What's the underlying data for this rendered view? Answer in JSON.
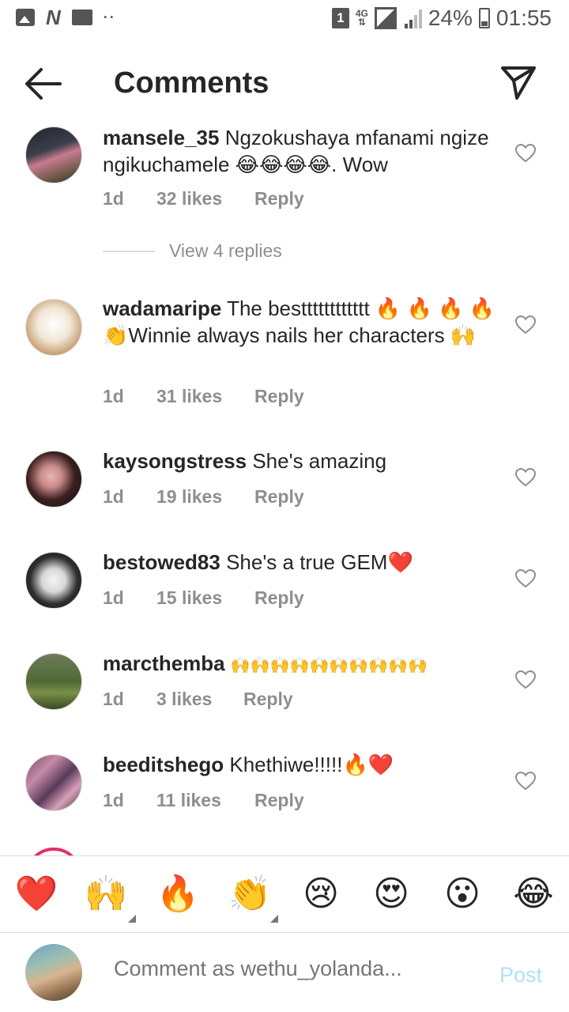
{
  "status_bar": {
    "notification_badge": "1",
    "network": "4G",
    "battery": "24%",
    "time": "01:55"
  },
  "header": {
    "title": "Comments"
  },
  "comments": [
    {
      "user": "mansele_35",
      "text": "Ngzokushaya mfanami ngize ngikuchamele 😂😂😂😂. Wow",
      "age": "1d",
      "likes": "32 likes",
      "reply": "Reply"
    },
    {
      "user": "wadamaripe",
      "text": "The bestttttttttttt 🔥 🔥 🔥 🔥 👏Winnie always nails her characters 🙌",
      "age": "1d",
      "likes": "31 likes",
      "reply": "Reply"
    },
    {
      "user": "kaysongstress",
      "text": "She's amazing",
      "age": "1d",
      "likes": "19 likes",
      "reply": "Reply"
    },
    {
      "user": "bestowed83",
      "text": "She's a true GEM❤️",
      "age": "1d",
      "likes": "15 likes",
      "reply": "Reply"
    },
    {
      "user": "marcthemba",
      "text": "🙌🙌🙌🙌🙌🙌🙌🙌🙌🙌",
      "age": "1d",
      "likes": "3 likes",
      "reply": "Reply"
    },
    {
      "user": "beeditshego",
      "text": "Khethiwe!!!!!🔥❤️",
      "age": "1d",
      "likes": "11 likes",
      "reply": "Reply"
    }
  ],
  "view_replies": "View 4 replies",
  "emoji_bar": [
    "❤️",
    "🙌",
    "🔥",
    "👏",
    "😢",
    "😍",
    "😮",
    "😂"
  ],
  "composer": {
    "placeholder": "Comment as wethu_yolanda...",
    "post_label": "Post"
  },
  "colors": {
    "text": "#262626",
    "meta": "#8e8e8e",
    "post_disabled": "#b2dffc",
    "story_ring": "#e1306c"
  }
}
